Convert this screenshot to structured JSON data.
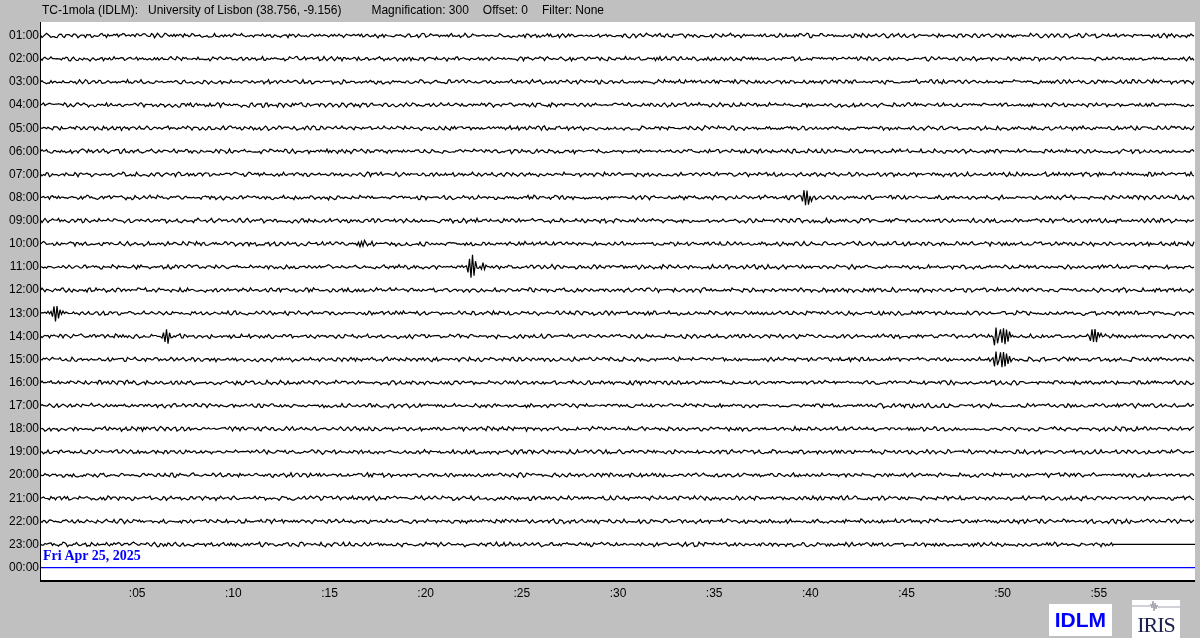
{
  "header": {
    "station": "TC-1mola (IDLM):",
    "location": "University of Lisbon (38.756, -9.156)",
    "magnification": "Magnification: 300",
    "offset": "Offset: 0",
    "filter": "Filter: None"
  },
  "rows": [
    {
      "time": "01:00",
      "kind": "trace"
    },
    {
      "time": "02:00",
      "kind": "trace"
    },
    {
      "time": "03:00",
      "kind": "trace"
    },
    {
      "time": "04:00",
      "kind": "trace"
    },
    {
      "time": "05:00",
      "kind": "trace"
    },
    {
      "time": "06:00",
      "kind": "trace"
    },
    {
      "time": "07:00",
      "kind": "trace"
    },
    {
      "time": "08:00",
      "kind": "trace"
    },
    {
      "time": "09:00",
      "kind": "trace"
    },
    {
      "time": "10:00",
      "kind": "trace"
    },
    {
      "time": "11:00",
      "kind": "trace"
    },
    {
      "time": "12:00",
      "kind": "trace"
    },
    {
      "time": "13:00",
      "kind": "trace"
    },
    {
      "time": "14:00",
      "kind": "trace"
    },
    {
      "time": "15:00",
      "kind": "trace"
    },
    {
      "time": "16:00",
      "kind": "trace"
    },
    {
      "time": "17:00",
      "kind": "trace"
    },
    {
      "time": "18:00",
      "kind": "trace"
    },
    {
      "time": "19:00",
      "kind": "trace"
    },
    {
      "time": "20:00",
      "kind": "trace"
    },
    {
      "time": "21:00",
      "kind": "trace"
    },
    {
      "time": "22:00",
      "kind": "trace"
    },
    {
      "time": "23:00",
      "kind": "trace"
    },
    {
      "time": "00:00",
      "kind": "current"
    }
  ],
  "date_label": "Fri Apr 25, 2025",
  "x_axis": [
    ":05",
    ":10",
    ":15",
    ":20",
    ":25",
    ":30",
    ":35",
    ":40",
    ":45",
    ":50",
    ":55"
  ],
  "logos": {
    "station": "IDLM",
    "network": "IRIS"
  }
}
